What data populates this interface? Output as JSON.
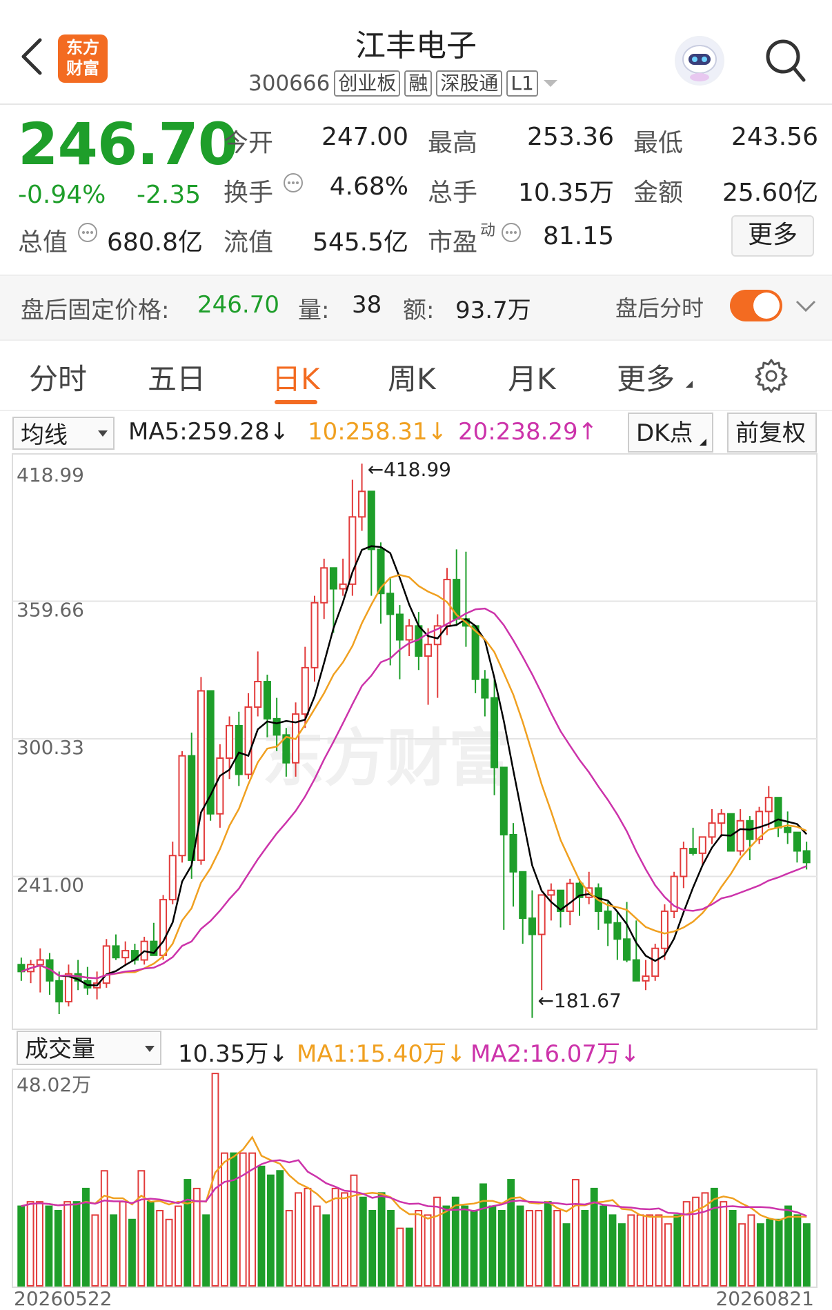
{
  "header": {
    "title": "江丰电子",
    "code": "300666",
    "tags": [
      "创业板",
      "融",
      "深股通",
      "L1"
    ],
    "logo_text": "东方\n财富"
  },
  "quote": {
    "price": "246.70",
    "change_pct": "-0.94%",
    "change": "-2.35",
    "open_label": "今开",
    "open": "247.00",
    "high_label": "最高",
    "high": "253.36",
    "low_label": "最低",
    "low": "243.56",
    "turnover_label": "换手",
    "turnover": "4.68%",
    "volume_label": "总手",
    "volume": "10.35万",
    "amount_label": "金额",
    "amount": "25.60亿",
    "mktcap_label": "总值",
    "mktcap": "680.8亿",
    "float_label": "流值",
    "float": "545.5亿",
    "pe_label": "市盈",
    "pe_sup": "动",
    "pe": "81.15",
    "more": "更多"
  },
  "after_hours": {
    "label": "盘后固定价格:",
    "price": "246.70",
    "vol_label": "量:",
    "vol": "38",
    "amt_label": "额:",
    "amt": "93.7万",
    "timeshare_label": "盘后分时",
    "toggle_on": true
  },
  "tabs": [
    "分时",
    "五日",
    "日K",
    "周K",
    "月K",
    "更多"
  ],
  "active_tab": "日K",
  "indicator": {
    "selector": "均线",
    "ma5": "MA5:259.28",
    "ma10": "10:258.31",
    "ma20": "20:238.29",
    "dk": "DK点",
    "adjust": "前复权"
  },
  "volume_indicator": {
    "selector": "成交量",
    "vol": "10.35万",
    "ma1": "MA1:15.40万",
    "ma2": "MA2:16.07万"
  },
  "colors": {
    "up": "#e23b3b",
    "down": "#1e9e2a",
    "ma5": "#000000",
    "ma10": "#f0a020",
    "ma20": "#cc33aa",
    "accent": "#f36b21"
  },
  "chart_data": [
    {
      "type": "candlestick",
      "title": "",
      "y_ticks": [
        "418.99",
        "359.66",
        "300.33",
        "241.00"
      ],
      "annotations": {
        "max": "418.99",
        "min": "181.67"
      },
      "ylim": [
        181.67,
        418.99
      ],
      "candles": [
        [
          203,
          206,
          196,
          200
        ],
        [
          200,
          205,
          195,
          203
        ],
        [
          203,
          210,
          191,
          205
        ],
        [
          205,
          208,
          190,
          196
        ],
        [
          196,
          200,
          181.67,
          187
        ],
        [
          187,
          203,
          185,
          199
        ],
        [
          199,
          205,
          192,
          196
        ],
        [
          196,
          202,
          190,
          193
        ],
        [
          193,
          200,
          188,
          195
        ],
        [
          195,
          214,
          193,
          211
        ],
        [
          211,
          216,
          205,
          206
        ],
        [
          206,
          213,
          203,
          209
        ],
        [
          209,
          212,
          203,
          205
        ],
        [
          205,
          215,
          203,
          213
        ],
        [
          213,
          221,
          207,
          207
        ],
        [
          207,
          233,
          205,
          231
        ],
        [
          231,
          256,
          229,
          250
        ],
        [
          250,
          295,
          247,
          293
        ],
        [
          293,
          303,
          240,
          248
        ],
        [
          248,
          327,
          246,
          321
        ],
        [
          321,
          300,
          265,
          268
        ],
        [
          268,
          298,
          262,
          292
        ],
        [
          292,
          310,
          283,
          306
        ],
        [
          306,
          312,
          280,
          285
        ],
        [
          285,
          320,
          283,
          314
        ],
        [
          314,
          338,
          310,
          325
        ],
        [
          325,
          328,
          301,
          309
        ],
        [
          309,
          318,
          295,
          302
        ],
        [
          302,
          305,
          284,
          290
        ],
        [
          290,
          316,
          284,
          311
        ],
        [
          311,
          340,
          305,
          331
        ],
        [
          331,
          362,
          325,
          359
        ],
        [
          359,
          378,
          352,
          374
        ],
        [
          374,
          372,
          346,
          365
        ],
        [
          365,
          378,
          362,
          367
        ],
        [
          367,
          412,
          362,
          396
        ],
        [
          396,
          418.99,
          390,
          407
        ],
        [
          407,
          406,
          362,
          382
        ],
        [
          382,
          385,
          350,
          363
        ],
        [
          363,
          370,
          332,
          354
        ],
        [
          354,
          358,
          326,
          343
        ],
        [
          343,
          352,
          336,
          349
        ],
        [
          349,
          355,
          330,
          336
        ],
        [
          336,
          348,
          315,
          341
        ],
        [
          341,
          354,
          318,
          349
        ],
        [
          349,
          374,
          345,
          369
        ],
        [
          369,
          382,
          349,
          352
        ],
        [
          352,
          381,
          340,
          349
        ],
        [
          349,
          343,
          320,
          326
        ],
        [
          326,
          330,
          310,
          318
        ],
        [
          318,
          326,
          276,
          288
        ],
        [
          288,
          275,
          218,
          259
        ],
        [
          259,
          264,
          228,
          243
        ],
        [
          243,
          240,
          212,
          223
        ],
        [
          223,
          235,
          180,
          216
        ],
        [
          216,
          232,
          192,
          233
        ],
        [
          233,
          238,
          222,
          235
        ],
        [
          235,
          232,
          219,
          226
        ],
        [
          226,
          240,
          220,
          238
        ],
        [
          238,
          240,
          224,
          232
        ],
        [
          232,
          243,
          229,
          236
        ],
        [
          236,
          238,
          218,
          226
        ],
        [
          226,
          230,
          211,
          221
        ],
        [
          221,
          226,
          205,
          214
        ],
        [
          214,
          230,
          204,
          205
        ],
        [
          205,
          222,
          200,
          196
        ],
        [
          196,
          205,
          192,
          198
        ],
        [
          198,
          212,
          196,
          210
        ],
        [
          210,
          229,
          205,
          226
        ],
        [
          226,
          243,
          223,
          241
        ],
        [
          241,
          256,
          236,
          253
        ],
        [
          253,
          262,
          250,
          251
        ],
        [
          251,
          257,
          246,
          258
        ],
        [
          258,
          270,
          255,
          264
        ],
        [
          264,
          270,
          258,
          268
        ],
        [
          268,
          267,
          252,
          252
        ],
        [
          252,
          270,
          250,
          265
        ],
        [
          265,
          267,
          248,
          257
        ],
        [
          257,
          271,
          255,
          269
        ],
        [
          269,
          280,
          262,
          275
        ],
        [
          275,
          270,
          258,
          262
        ],
        [
          262,
          269,
          255,
          260
        ],
        [
          260,
          259,
          247,
          252
        ],
        [
          252,
          256,
          244,
          247
        ]
      ]
    },
    {
      "type": "bar",
      "title": "",
      "y_ticks": [
        "48.02万"
      ],
      "x_start_label": "20260522",
      "x_end_label": "20260821",
      "ylim": [
        0,
        48.02
      ],
      "values": [
        18,
        19,
        19,
        18,
        17,
        19,
        19,
        22,
        16,
        26,
        16,
        19,
        15,
        26,
        19,
        17,
        15,
        18,
        24,
        22,
        16,
        48,
        30,
        30,
        30,
        30,
        27,
        25,
        26,
        17,
        21,
        22,
        18,
        16,
        22,
        21,
        25,
        20,
        17,
        21,
        17,
        13,
        13,
        17,
        16,
        20,
        18,
        20,
        18,
        17,
        23,
        18,
        17,
        24,
        18,
        17,
        17,
        19,
        17,
        14,
        24,
        17,
        22,
        18,
        16,
        14,
        16,
        16,
        16,
        16,
        14,
        16,
        19,
        20,
        21,
        22,
        19,
        17,
        14,
        16,
        14,
        15,
        15,
        18,
        16,
        14
      ]
    }
  ]
}
